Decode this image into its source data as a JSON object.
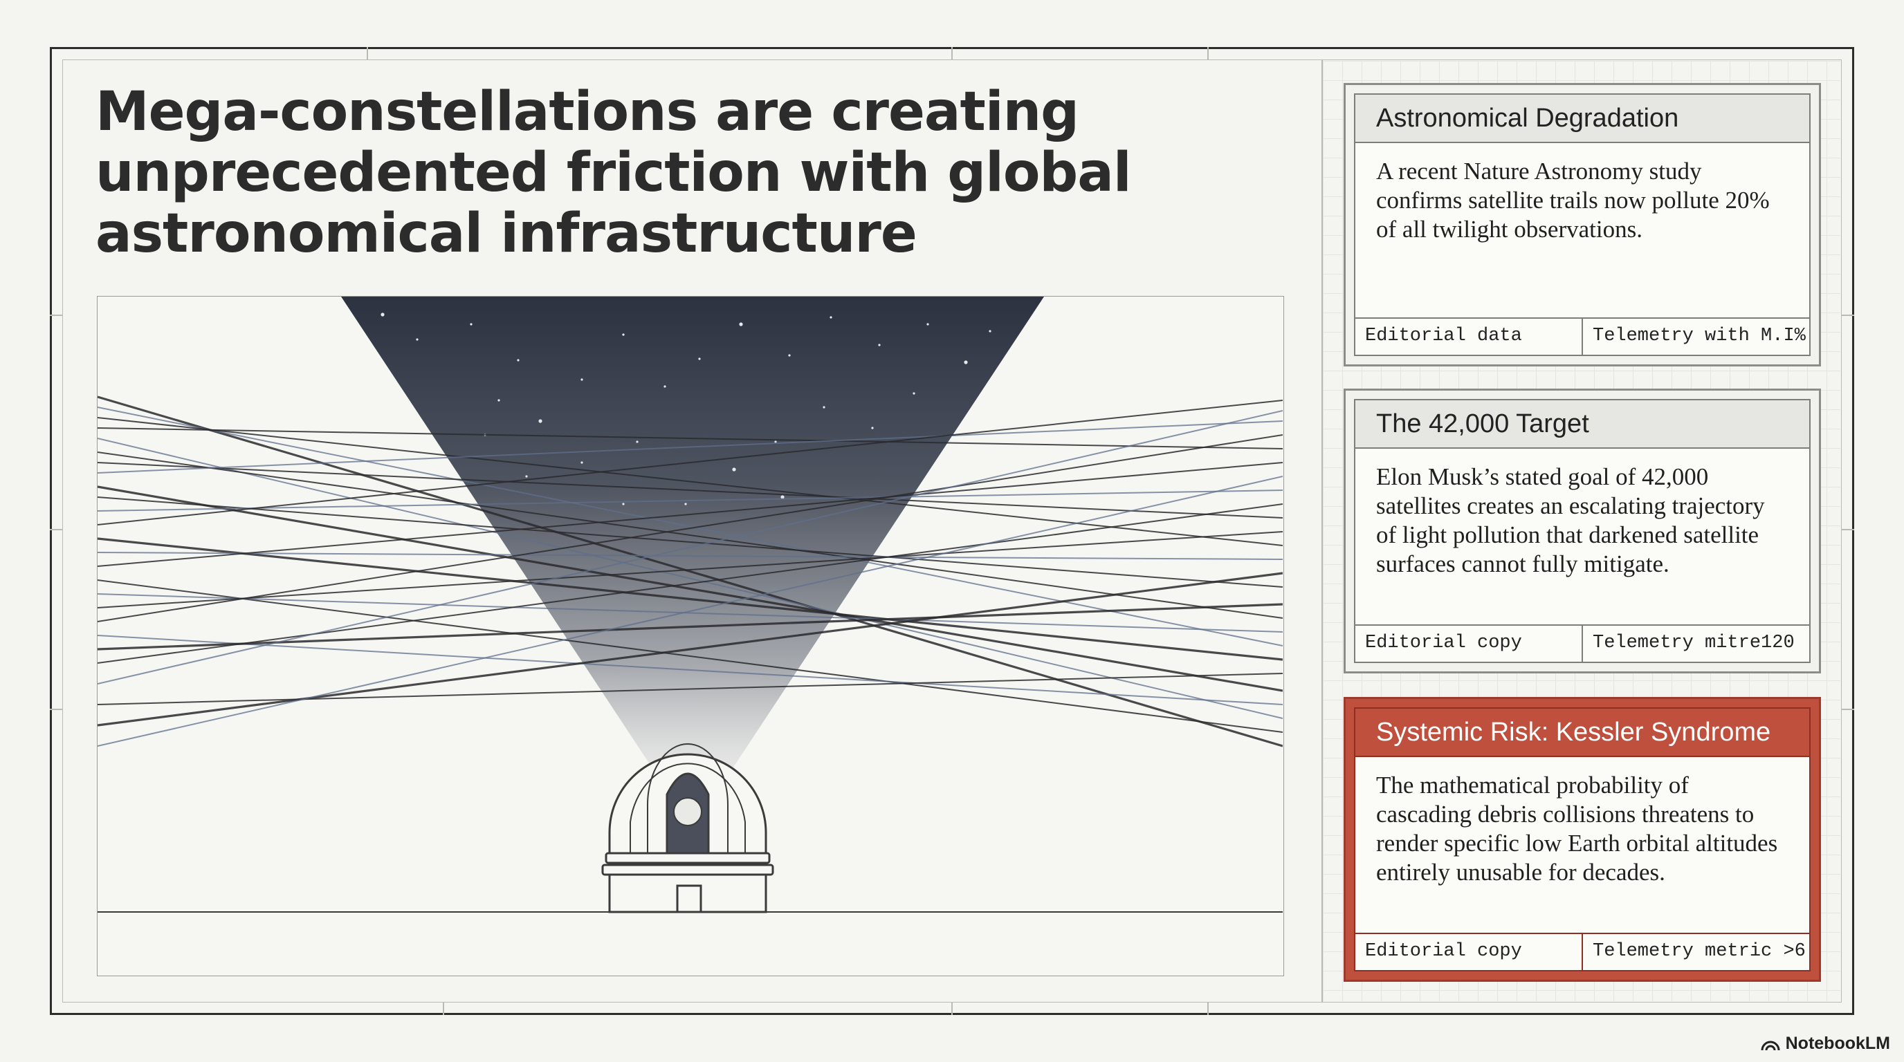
{
  "title": "Mega-constellations are creating unprecedented friction with global astronomical infrastructure",
  "cards": [
    {
      "heading": "Astronomical Degradation",
      "body": "A recent Nature Astronomy study confirms satellite trails now pollute 20% of all twilight observations.",
      "foot_left": "Editorial data",
      "foot_right": "Telemetry with M.I%",
      "style": "neutral"
    },
    {
      "heading": "The 42,000 Target",
      "body": "Elon Musk’s stated goal of 42,000 satellites creates an escalating trajectory of light pollution that darkened satellite surfaces cannot fully mitigate.",
      "foot_left": "Editorial copy",
      "foot_right": "Telemetry mitre120",
      "style": "neutral"
    },
    {
      "heading": "Systemic Risk: Kessler Syndrome",
      "body": "The mathematical probability of cascading debris collisions threatens to render specific low Earth orbital altitudes entirely unusable for decades.",
      "foot_left": "Editorial copy",
      "foot_right": "Telemetry metric >6",
      "style": "alert"
    }
  ],
  "brand": "NotebookLM",
  "colors": {
    "background": "#f4f4f1",
    "alert": "#c0503e",
    "sky_top": "#2c3240",
    "trail_dark": "#2a2a2e",
    "trail_blue": "#5f6f8c"
  },
  "illustration": {
    "icon": "observatory-dome-icon"
  }
}
